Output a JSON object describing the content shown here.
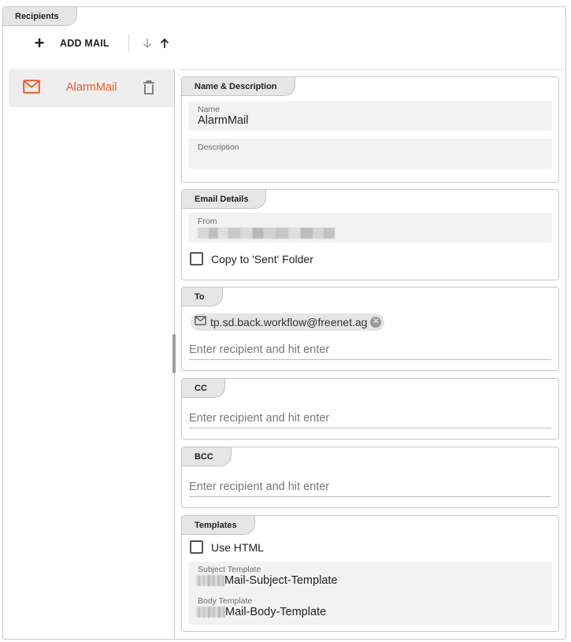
{
  "recipients_tab": "Recipients",
  "toolbar": {
    "add_label": "ADD MAIL"
  },
  "mail_list": [
    {
      "label": "AlarmMail"
    }
  ],
  "sections": {
    "name_desc": {
      "title": "Name & Description",
      "name_label": "Name",
      "name_value": "AlarmMail",
      "desc_label": "Description",
      "desc_value": ""
    },
    "email_details": {
      "title": "Email Details",
      "from_label": "From",
      "copy_label": "Copy to 'Sent' Folder"
    },
    "to": {
      "title": "To",
      "chips": [
        "tp.sd.back.workflow@freenet.ag"
      ],
      "placeholder": "Enter recipient and hit enter"
    },
    "cc": {
      "title": "CC",
      "placeholder": "Enter recipient and hit enter"
    },
    "bcc": {
      "title": "BCC",
      "placeholder": "Enter recipient and hit enter"
    },
    "templates": {
      "title": "Templates",
      "use_html_label": "Use HTML",
      "subject_label": "Subject Template",
      "subject_value": "Mail-Subject-Template",
      "body_label": "Body Template",
      "body_value": "Mail-Body-Template"
    }
  },
  "colors": {
    "accent": "#f05a28",
    "field_bg": "#f2f2f2",
    "tab_bg": "#e6e6e6",
    "border": "#c8c8c8"
  }
}
